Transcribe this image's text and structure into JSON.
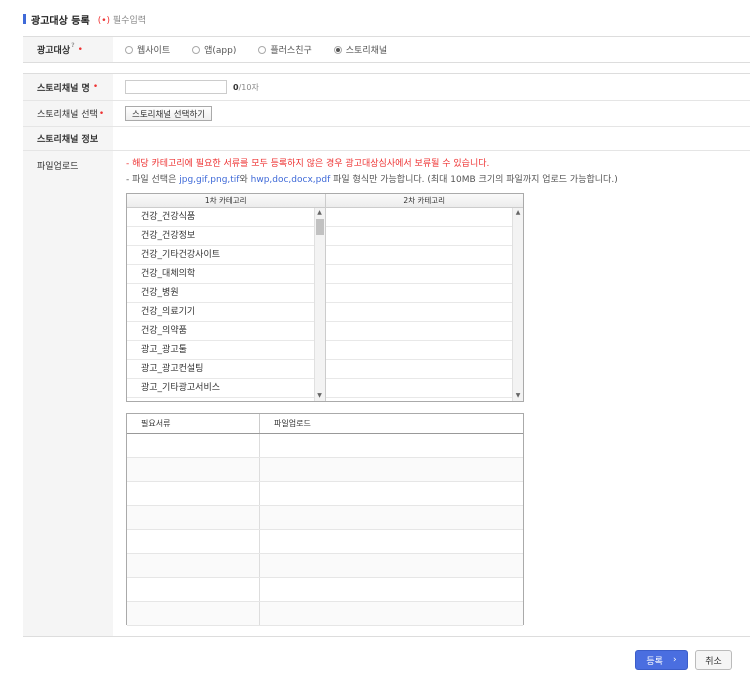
{
  "header": {
    "title": "광고대상 등록",
    "required_star": "(•)",
    "required_label": "필수입력"
  },
  "target_section": {
    "label": "광고대상",
    "help_mark": "?",
    "star": "•",
    "options": [
      {
        "label": "웹사이트",
        "selected": false
      },
      {
        "label": "앱(app)",
        "selected": false
      },
      {
        "label": "플러스친구",
        "selected": false
      },
      {
        "label": "스토리채널",
        "selected": true
      }
    ]
  },
  "form": {
    "channel_name_label": "스토리채널 명",
    "channel_name_star": "•",
    "channel_name_value": "",
    "counter_current": "0",
    "counter_max": "/10자",
    "channel_select_label": "스토리채널 선택",
    "channel_select_star": "•",
    "channel_select_button": "스토리채널 선택하기",
    "channel_info_label": "스토리채널 정보",
    "file_upload_label": "파일업로드"
  },
  "notes": {
    "warning": "- 해당 카테고리에 필요한 서류를 모두 등록하지 않은 경우 광고대상심사에서 보류될 수 있습니다.",
    "format_prefix": "- 파일 선택은",
    "format_images": "jpg,gif,png,tif",
    "format_joiner": "와",
    "format_docs": "hwp,doc,docx,pdf",
    "format_suffix": "파일 형식만 가능합니다. (최대 10MB 크기의 파일까지 업로드 가능합니다.)"
  },
  "category": {
    "col1_header": "1차 카테고리",
    "col2_header": "2차 카테고리",
    "items": [
      "건강_건강식품",
      "건강_건강정보",
      "건강_기타건강사이트",
      "건강_대체의학",
      "건강_병원",
      "건강_의료기기",
      "건강_의약품",
      "광고_광고툴",
      "광고_광고컨설팅",
      "광고_기타광고서비스"
    ],
    "scroll_up": "▲",
    "scroll_down": "▼"
  },
  "documents": {
    "col1_header": "필요서류",
    "col2_header": "파일업로드",
    "row_count": 8
  },
  "buttons": {
    "submit_label": "등록",
    "submit_chevron": "›",
    "cancel_label": "취소"
  },
  "colors": {
    "accent": "#4a6ee0",
    "required": "#ee3333",
    "header_bg": "#f5f5f5"
  }
}
